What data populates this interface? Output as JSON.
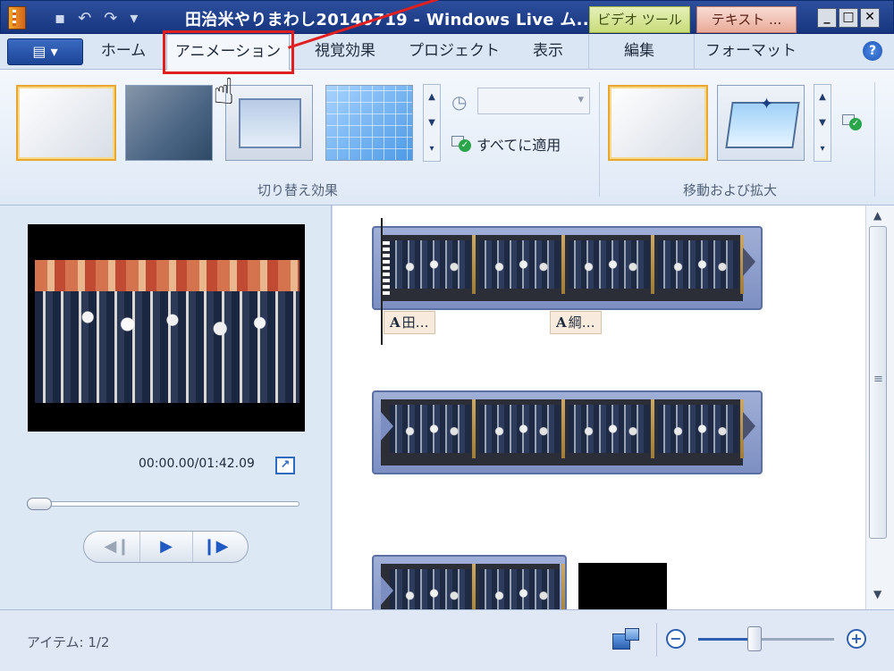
{
  "window": {
    "title": "田治米やりまわし20140719 - Windows Live ム...",
    "context_tab_video": "ビデオ ツール",
    "context_tab_text": "テキスト ...",
    "min_label": "_",
    "max_label": "□",
    "close_label": "✕"
  },
  "ribbon": {
    "file_menu_label": "▤ ▾",
    "tabs": [
      "ホーム",
      "アニメーション",
      "視覚効果",
      "プロジェクト",
      "表示",
      "編集",
      "フォーマット"
    ],
    "active_tab": "アニメーション",
    "help_label": "?",
    "transitions_group_label": "切り替え効果",
    "apply_all_label": "すべてに適用",
    "pan_zoom_group_label": "移動および拡大"
  },
  "preview": {
    "timecode": "00:00.00/01:42.09",
    "seek_fraction": 0.0
  },
  "storyboard": {
    "captions": [
      "田…",
      "綱…"
    ],
    "caption_glyph": "A"
  },
  "statusbar": {
    "item_count": "アイテム: 1/2",
    "zoom_out_label": "−",
    "zoom_in_label": "+"
  },
  "colors": {
    "annotation": "#e02020",
    "title_bar": "#1f3f8a",
    "context_video": "#c9dc7a",
    "context_text": "#e9aa98"
  }
}
